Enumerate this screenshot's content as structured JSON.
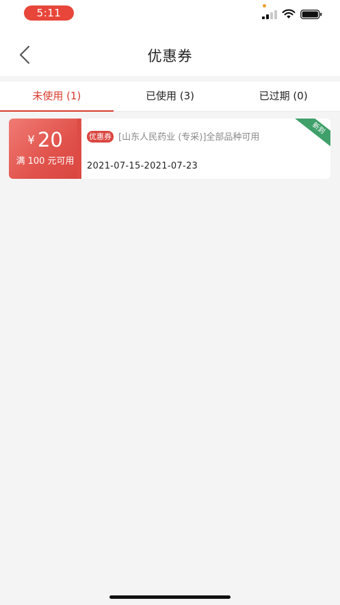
{
  "status_bar": {
    "time": "5:11",
    "icons": [
      "signal-icon",
      "wifi-icon",
      "battery-icon"
    ]
  },
  "nav": {
    "title": "优惠券",
    "back_icon": "chevron-left-icon"
  },
  "tabs": [
    {
      "label": "未使用 (1)",
      "active": true
    },
    {
      "label": "已使用 (3)",
      "active": false
    },
    {
      "label": "已过期 (0)",
      "active": false
    }
  ],
  "coupon": {
    "currency": "¥",
    "amount": "20",
    "threshold": "满 100 元可用",
    "tag": "优惠券",
    "description": "[山东人民药业 (专采)]全部品种可用",
    "dates": "2021-07-15-2021-07-23",
    "ribbon": "新到"
  },
  "colors": {
    "accent": "#d83a2c",
    "time_pill": "#e8463a",
    "ribbon": "#3fa06a",
    "background": "#f4f4f4"
  }
}
